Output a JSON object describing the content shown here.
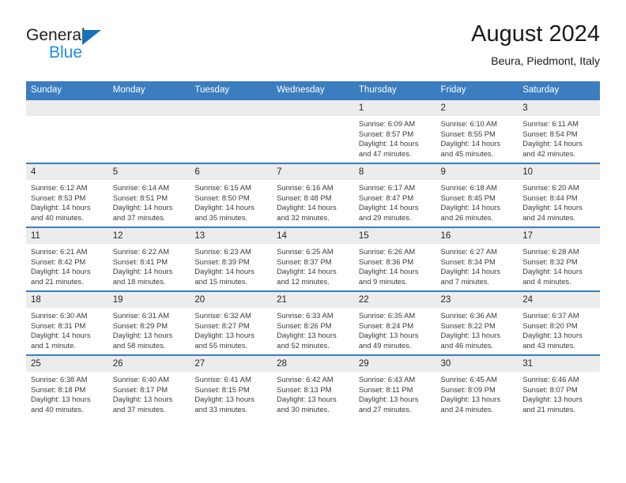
{
  "logo": {
    "word_top": "General",
    "word_bottom": "Blue",
    "triangle_color": "#1c72b8",
    "blue_text_color": "#1c8fe0"
  },
  "header": {
    "title": "August 2024",
    "subtitle": "Beura, Piedmont, Italy",
    "accent_color": "#3b7dbf",
    "daynum_strip_color": "#ececec"
  },
  "weekday_headers": [
    "Sunday",
    "Monday",
    "Tuesday",
    "Wednesday",
    "Thursday",
    "Friday",
    "Saturday"
  ],
  "labels": {
    "sunrise_prefix": "Sunrise:",
    "sunset_prefix": "Sunset:",
    "daylight_prefix": "Daylight:"
  },
  "weeks": [
    [
      {
        "day": "",
        "empty": true,
        "sunrise": "",
        "sunset": "",
        "daylight_line1": "",
        "daylight_line2": ""
      },
      {
        "day": "",
        "empty": true,
        "sunrise": "",
        "sunset": "",
        "daylight_line1": "",
        "daylight_line2": ""
      },
      {
        "day": "",
        "empty": true,
        "sunrise": "",
        "sunset": "",
        "daylight_line1": "",
        "daylight_line2": ""
      },
      {
        "day": "",
        "empty": true,
        "sunrise": "",
        "sunset": "",
        "daylight_line1": "",
        "daylight_line2": ""
      },
      {
        "day": "1",
        "empty": false,
        "sunrise": "Sunrise: 6:09 AM",
        "sunset": "Sunset: 8:57 PM",
        "daylight_line1": "Daylight: 14 hours",
        "daylight_line2": "and 47 minutes."
      },
      {
        "day": "2",
        "empty": false,
        "sunrise": "Sunrise: 6:10 AM",
        "sunset": "Sunset: 8:55 PM",
        "daylight_line1": "Daylight: 14 hours",
        "daylight_line2": "and 45 minutes."
      },
      {
        "day": "3",
        "empty": false,
        "sunrise": "Sunrise: 6:11 AM",
        "sunset": "Sunset: 8:54 PM",
        "daylight_line1": "Daylight: 14 hours",
        "daylight_line2": "and 42 minutes."
      }
    ],
    [
      {
        "day": "4",
        "empty": false,
        "sunrise": "Sunrise: 6:12 AM",
        "sunset": "Sunset: 8:53 PM",
        "daylight_line1": "Daylight: 14 hours",
        "daylight_line2": "and 40 minutes."
      },
      {
        "day": "5",
        "empty": false,
        "sunrise": "Sunrise: 6:14 AM",
        "sunset": "Sunset: 8:51 PM",
        "daylight_line1": "Daylight: 14 hours",
        "daylight_line2": "and 37 minutes."
      },
      {
        "day": "6",
        "empty": false,
        "sunrise": "Sunrise: 6:15 AM",
        "sunset": "Sunset: 8:50 PM",
        "daylight_line1": "Daylight: 14 hours",
        "daylight_line2": "and 35 minutes."
      },
      {
        "day": "7",
        "empty": false,
        "sunrise": "Sunrise: 6:16 AM",
        "sunset": "Sunset: 8:48 PM",
        "daylight_line1": "Daylight: 14 hours",
        "daylight_line2": "and 32 minutes."
      },
      {
        "day": "8",
        "empty": false,
        "sunrise": "Sunrise: 6:17 AM",
        "sunset": "Sunset: 8:47 PM",
        "daylight_line1": "Daylight: 14 hours",
        "daylight_line2": "and 29 minutes."
      },
      {
        "day": "9",
        "empty": false,
        "sunrise": "Sunrise: 6:18 AM",
        "sunset": "Sunset: 8:45 PM",
        "daylight_line1": "Daylight: 14 hours",
        "daylight_line2": "and 26 minutes."
      },
      {
        "day": "10",
        "empty": false,
        "sunrise": "Sunrise: 6:20 AM",
        "sunset": "Sunset: 8:44 PM",
        "daylight_line1": "Daylight: 14 hours",
        "daylight_line2": "and 24 minutes."
      }
    ],
    [
      {
        "day": "11",
        "empty": false,
        "sunrise": "Sunrise: 6:21 AM",
        "sunset": "Sunset: 8:42 PM",
        "daylight_line1": "Daylight: 14 hours",
        "daylight_line2": "and 21 minutes."
      },
      {
        "day": "12",
        "empty": false,
        "sunrise": "Sunrise: 6:22 AM",
        "sunset": "Sunset: 8:41 PM",
        "daylight_line1": "Daylight: 14 hours",
        "daylight_line2": "and 18 minutes."
      },
      {
        "day": "13",
        "empty": false,
        "sunrise": "Sunrise: 6:23 AM",
        "sunset": "Sunset: 8:39 PM",
        "daylight_line1": "Daylight: 14 hours",
        "daylight_line2": "and 15 minutes."
      },
      {
        "day": "14",
        "empty": false,
        "sunrise": "Sunrise: 6:25 AM",
        "sunset": "Sunset: 8:37 PM",
        "daylight_line1": "Daylight: 14 hours",
        "daylight_line2": "and 12 minutes."
      },
      {
        "day": "15",
        "empty": false,
        "sunrise": "Sunrise: 6:26 AM",
        "sunset": "Sunset: 8:36 PM",
        "daylight_line1": "Daylight: 14 hours",
        "daylight_line2": "and 9 minutes."
      },
      {
        "day": "16",
        "empty": false,
        "sunrise": "Sunrise: 6:27 AM",
        "sunset": "Sunset: 8:34 PM",
        "daylight_line1": "Daylight: 14 hours",
        "daylight_line2": "and 7 minutes."
      },
      {
        "day": "17",
        "empty": false,
        "sunrise": "Sunrise: 6:28 AM",
        "sunset": "Sunset: 8:32 PM",
        "daylight_line1": "Daylight: 14 hours",
        "daylight_line2": "and 4 minutes."
      }
    ],
    [
      {
        "day": "18",
        "empty": false,
        "sunrise": "Sunrise: 6:30 AM",
        "sunset": "Sunset: 8:31 PM",
        "daylight_line1": "Daylight: 14 hours",
        "daylight_line2": "and 1 minute."
      },
      {
        "day": "19",
        "empty": false,
        "sunrise": "Sunrise: 6:31 AM",
        "sunset": "Sunset: 8:29 PM",
        "daylight_line1": "Daylight: 13 hours",
        "daylight_line2": "and 58 minutes."
      },
      {
        "day": "20",
        "empty": false,
        "sunrise": "Sunrise: 6:32 AM",
        "sunset": "Sunset: 8:27 PM",
        "daylight_line1": "Daylight: 13 hours",
        "daylight_line2": "and 55 minutes."
      },
      {
        "day": "21",
        "empty": false,
        "sunrise": "Sunrise: 6:33 AM",
        "sunset": "Sunset: 8:26 PM",
        "daylight_line1": "Daylight: 13 hours",
        "daylight_line2": "and 52 minutes."
      },
      {
        "day": "22",
        "empty": false,
        "sunrise": "Sunrise: 6:35 AM",
        "sunset": "Sunset: 8:24 PM",
        "daylight_line1": "Daylight: 13 hours",
        "daylight_line2": "and 49 minutes."
      },
      {
        "day": "23",
        "empty": false,
        "sunrise": "Sunrise: 6:36 AM",
        "sunset": "Sunset: 8:22 PM",
        "daylight_line1": "Daylight: 13 hours",
        "daylight_line2": "and 46 minutes."
      },
      {
        "day": "24",
        "empty": false,
        "sunrise": "Sunrise: 6:37 AM",
        "sunset": "Sunset: 8:20 PM",
        "daylight_line1": "Daylight: 13 hours",
        "daylight_line2": "and 43 minutes."
      }
    ],
    [
      {
        "day": "25",
        "empty": false,
        "sunrise": "Sunrise: 6:38 AM",
        "sunset": "Sunset: 8:18 PM",
        "daylight_line1": "Daylight: 13 hours",
        "daylight_line2": "and 40 minutes."
      },
      {
        "day": "26",
        "empty": false,
        "sunrise": "Sunrise: 6:40 AM",
        "sunset": "Sunset: 8:17 PM",
        "daylight_line1": "Daylight: 13 hours",
        "daylight_line2": "and 37 minutes."
      },
      {
        "day": "27",
        "empty": false,
        "sunrise": "Sunrise: 6:41 AM",
        "sunset": "Sunset: 8:15 PM",
        "daylight_line1": "Daylight: 13 hours",
        "daylight_line2": "and 33 minutes."
      },
      {
        "day": "28",
        "empty": false,
        "sunrise": "Sunrise: 6:42 AM",
        "sunset": "Sunset: 8:13 PM",
        "daylight_line1": "Daylight: 13 hours",
        "daylight_line2": "and 30 minutes."
      },
      {
        "day": "29",
        "empty": false,
        "sunrise": "Sunrise: 6:43 AM",
        "sunset": "Sunset: 8:11 PM",
        "daylight_line1": "Daylight: 13 hours",
        "daylight_line2": "and 27 minutes."
      },
      {
        "day": "30",
        "empty": false,
        "sunrise": "Sunrise: 6:45 AM",
        "sunset": "Sunset: 8:09 PM",
        "daylight_line1": "Daylight: 13 hours",
        "daylight_line2": "and 24 minutes."
      },
      {
        "day": "31",
        "empty": false,
        "sunrise": "Sunrise: 6:46 AM",
        "sunset": "Sunset: 8:07 PM",
        "daylight_line1": "Daylight: 13 hours",
        "daylight_line2": "and 21 minutes."
      }
    ]
  ]
}
